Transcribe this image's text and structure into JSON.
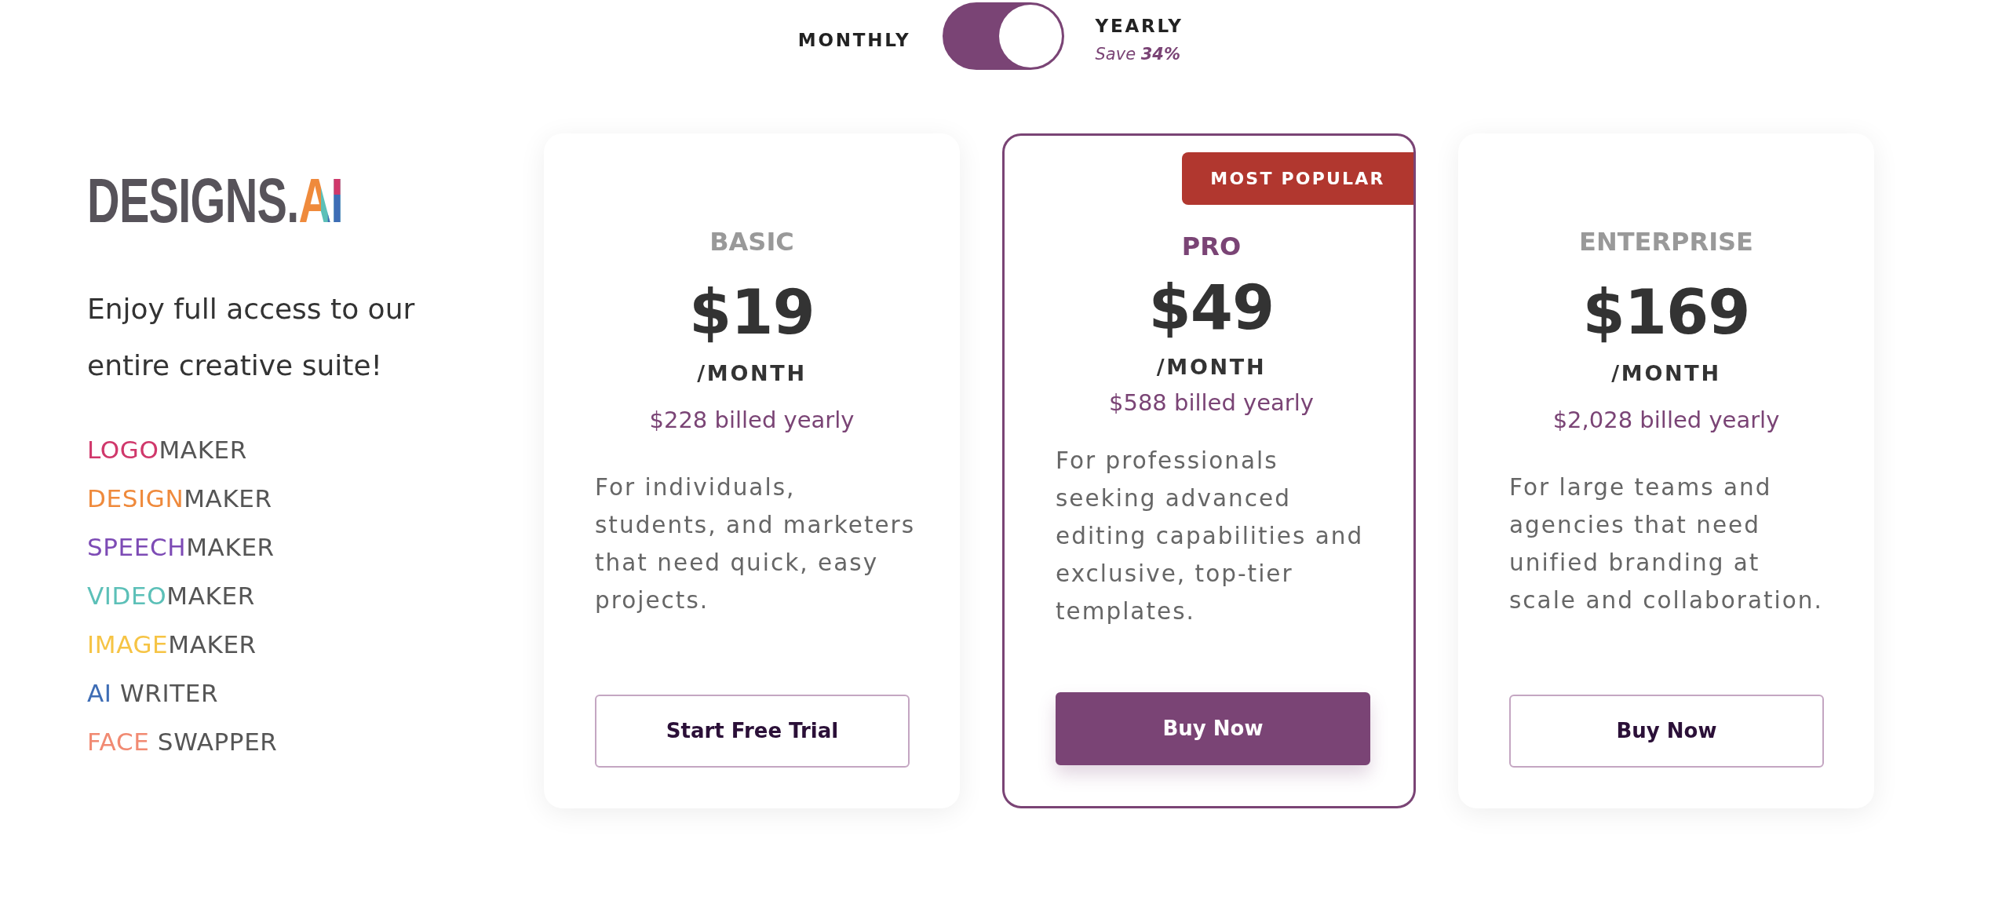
{
  "billing_toggle": {
    "left_label": "MONTHLY",
    "right_label": "YEARLY",
    "right_note": "Save **34%**",
    "on": true
  },
  "brand": {
    "name": "DESIGNS.",
    "accent": "AI"
  },
  "tagline": "Enjoy full access to our entire creative suite!",
  "products": [
    {
      "accent": "LOGO",
      "rest": "MAKER",
      "color": "#d0386b"
    },
    {
      "accent": "DESIGN",
      "rest": "MAKER",
      "color": "#ef8a3c"
    },
    {
      "accent": "SPEECH",
      "rest": "MAKER",
      "color": "#7d4bb5"
    },
    {
      "accent": "VIDEO",
      "rest": "MAKER",
      "color": "#5cc0b8"
    },
    {
      "accent": "IMAGE",
      "rest": "MAKER",
      "color": "#f6c445"
    },
    {
      "accent": "AI",
      "rest": " WRITER",
      "color": "#3e6db5"
    },
    {
      "accent": "FACE",
      "rest": " SWAPPER",
      "color": "#f18a72"
    }
  ],
  "plans": [
    {
      "name": "BASIC",
      "price": "$19",
      "period": "/MONTH",
      "billed": "$228 billed yearly",
      "description": "For individuals, students, and marketers that need quick, easy projects.",
      "button": "Start Free Trial",
      "featured": false
    },
    {
      "name": "PRO",
      "badge": "MOST POPULAR",
      "price": "$49",
      "period": "/MONTH",
      "billed": "$588 billed yearly",
      "description": "For professionals seeking advanced editing capabilities and exclusive, top-tier templates.",
      "button": "Buy Now",
      "featured": true
    },
    {
      "name": "ENTERPRISE",
      "price": "$169",
      "period": "/MONTH",
      "billed": "$2,028 billed yearly",
      "description": "For large teams and agencies that need unified branding at scale and collaboration.",
      "button": "Buy Now",
      "featured": false
    }
  ]
}
